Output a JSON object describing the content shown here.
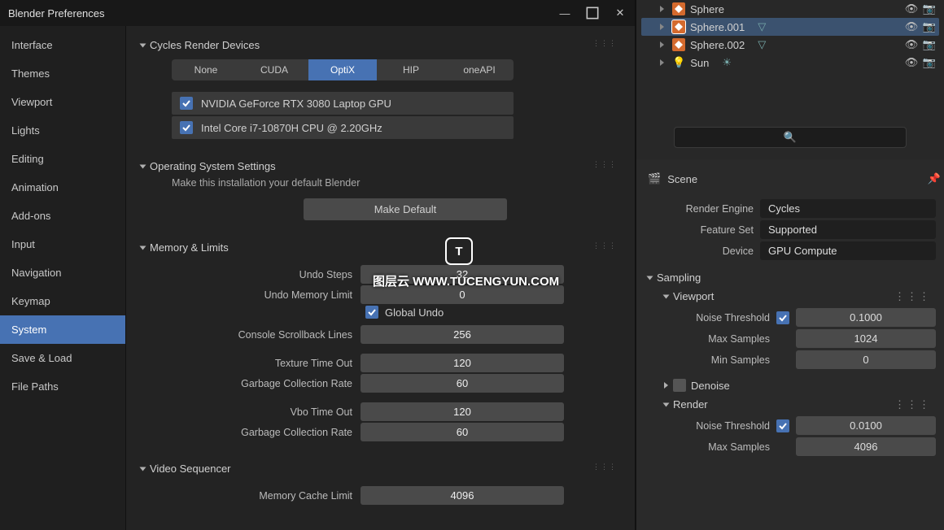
{
  "titlebar": {
    "title": "Blender Preferences"
  },
  "sidebar": {
    "tabs": [
      "Interface",
      "Themes",
      "Viewport",
      "Lights",
      "Editing",
      "Animation",
      "Add-ons",
      "Input",
      "Navigation",
      "Keymap",
      "System",
      "Save & Load",
      "File Paths"
    ],
    "active": "System"
  },
  "sections": {
    "cycles": {
      "title": "Cycles Render Devices",
      "tabs": [
        "None",
        "CUDA",
        "OptiX",
        "HIP",
        "oneAPI"
      ],
      "active_tab": "OptiX",
      "devices": [
        {
          "label": "NVIDIA GeForce RTX 3080 Laptop GPU",
          "checked": true
        },
        {
          "label": "Intel Core i7-10870H CPU @ 2.20GHz",
          "checked": true
        }
      ]
    },
    "os": {
      "title": "Operating System Settings",
      "subtext": "Make this installation your default Blender",
      "button": "Make Default"
    },
    "memory": {
      "title": "Memory & Limits",
      "undo_steps_label": "Undo Steps",
      "undo_steps": "32",
      "undo_mem_label": "Undo Memory Limit",
      "undo_mem": "0",
      "global_undo": "Global Undo",
      "console_label": "Console Scrollback Lines",
      "console": "256",
      "tex_timeout_label": "Texture Time Out",
      "tex_timeout": "120",
      "gc1_label": "Garbage Collection Rate",
      "gc1": "60",
      "vbo_label": "Vbo Time Out",
      "vbo": "120",
      "gc2_label": "Garbage Collection Rate",
      "gc2": "60"
    },
    "video": {
      "title": "Video Sequencer",
      "memcache_label": "Memory Cache Limit",
      "memcache": "4096"
    }
  },
  "outliner": {
    "items": [
      {
        "name": "Sphere",
        "selected": false,
        "indent": 1,
        "type": "mesh"
      },
      {
        "name": "Sphere.001",
        "selected": true,
        "indent": 1,
        "type": "mesh"
      },
      {
        "name": "Sphere.002",
        "selected": false,
        "indent": 1,
        "type": "mesh"
      },
      {
        "name": "Sun",
        "selected": false,
        "indent": 1,
        "type": "light"
      }
    ]
  },
  "props": {
    "context": "Scene",
    "render_engine_label": "Render Engine",
    "render_engine": "Cycles",
    "feature_set_label": "Feature Set",
    "feature_set": "Supported",
    "device_label": "Device",
    "device": "GPU Compute",
    "sampling": {
      "title": "Sampling",
      "viewport": {
        "title": "Viewport",
        "noise_label": "Noise Threshold",
        "noise_on": true,
        "noise": "0.1000",
        "max_label": "Max Samples",
        "max": "1024",
        "min_label": "Min Samples",
        "min": "0",
        "denoise": "Denoise"
      },
      "render": {
        "title": "Render",
        "noise_label": "Noise Threshold",
        "noise_on": true,
        "noise": "0.0100",
        "max_label": "Max Samples",
        "max": "4096"
      }
    }
  },
  "watermark": "图层云 WWW.TUCENGYUN.COM"
}
